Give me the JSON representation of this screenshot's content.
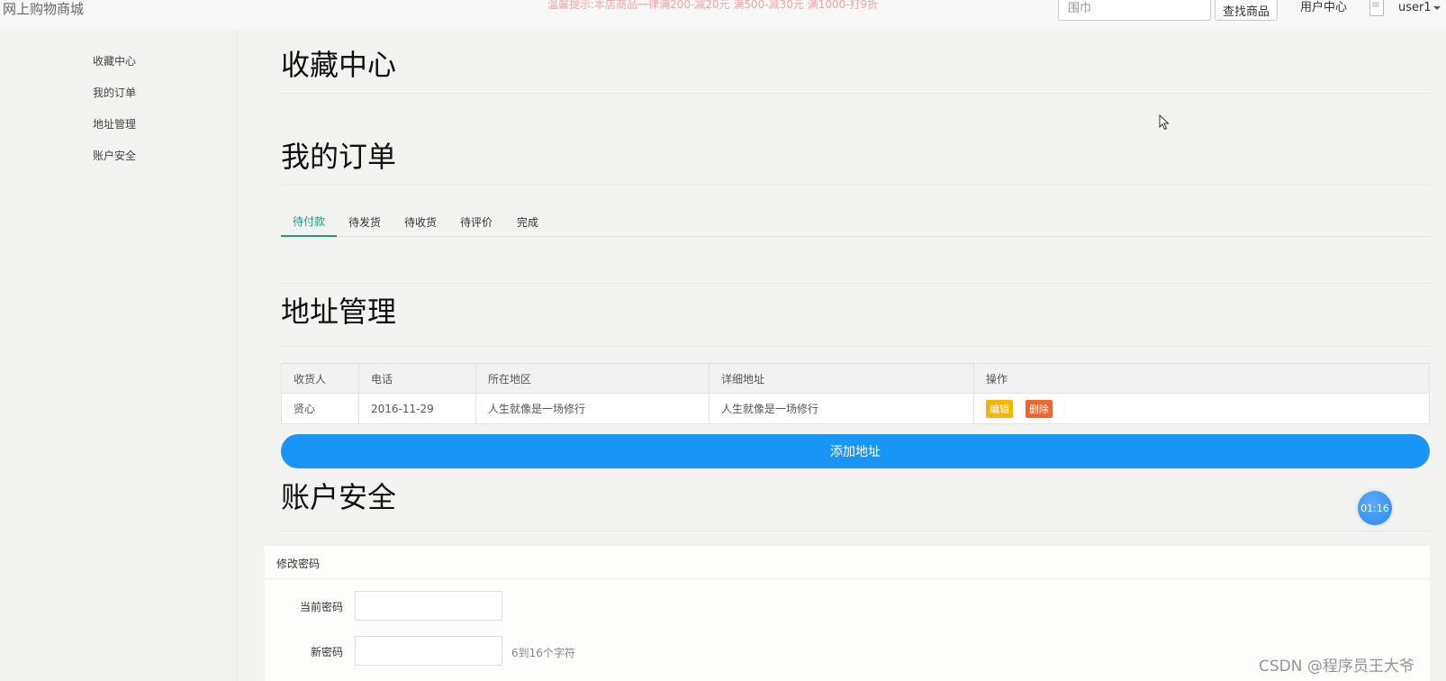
{
  "header": {
    "brand": "网上购物商城",
    "notice": "温馨提示:本店商品一律满200-减20元 满500-减30元 满1000-打9折",
    "search_placeholder": "围巾",
    "search_button": "查找商品",
    "user_center": "用户中心",
    "username": "user1"
  },
  "sidebar": {
    "items": [
      {
        "label": "收藏中心"
      },
      {
        "label": "我的订单"
      },
      {
        "label": "地址管理"
      },
      {
        "label": "账户安全"
      }
    ]
  },
  "sections": {
    "favorites_title": "收藏中心",
    "orders_title": "我的订单",
    "address_title": "地址管理",
    "security_title": "账户安全"
  },
  "order_tabs": [
    {
      "label": "待付款",
      "active": true
    },
    {
      "label": "待发货",
      "active": false
    },
    {
      "label": "待收货",
      "active": false
    },
    {
      "label": "待评价",
      "active": false
    },
    {
      "label": "完成",
      "active": false
    }
  ],
  "address_table": {
    "headers": [
      "收货人",
      "电话",
      "所在地区",
      "详细地址",
      "操作"
    ],
    "rows": [
      {
        "name": "贤心",
        "phone": "2016-11-29",
        "region": "人生就像是一场修行",
        "detail": "人生就像是一场修行",
        "edit": "编辑",
        "delete": "删除"
      }
    ]
  },
  "add_address_button": "添加地址",
  "password_form": {
    "title": "修改密码",
    "current_label": "当前密码",
    "new_label": "新密码",
    "new_hint": "6到16个字符"
  },
  "timer": "01:16",
  "watermark": "CSDN @程序员王大爷",
  "colors": {
    "accent_tab": "#1e9a7f",
    "add_button": "#1895f5",
    "edit_button": "#f7b500",
    "delete_button": "#f3642b"
  }
}
